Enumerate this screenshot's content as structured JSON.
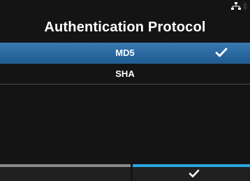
{
  "screen": {
    "title": "Authentication Protocol"
  },
  "status": {
    "icons": [
      "network-icon",
      "bluetooth-icon"
    ]
  },
  "options": [
    {
      "label": "MD5",
      "selected": true
    },
    {
      "label": "SHA",
      "selected": false
    }
  ],
  "softkeys": {
    "left": {
      "label": ""
    },
    "right": {
      "icon": "checkmark-icon"
    }
  },
  "colors": {
    "background": "#141414",
    "selected_row": "#2b6aa3",
    "left_softkey_accent": "#8a8a8a",
    "right_softkey_accent": "#29a9e0",
    "text": "#ffffff"
  }
}
